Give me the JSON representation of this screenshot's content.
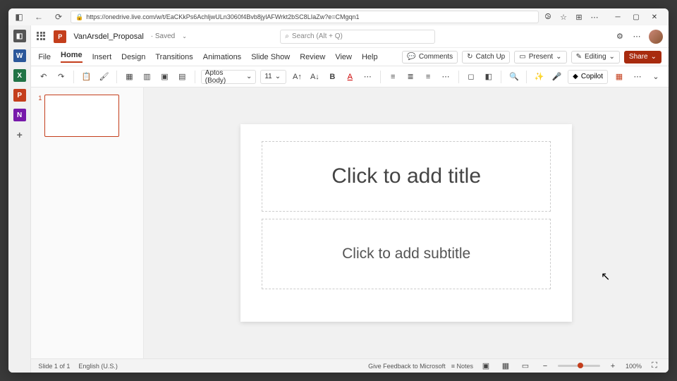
{
  "browser": {
    "url": "https://onedrive.live.com/w/t/EaCKkPs6AchljwULn3060f4Bvb8jylAFWrkt2bSC8LIaZw?e=CMgqn1",
    "favorite": "☆"
  },
  "appstrip": {
    "tab": "◧",
    "word": "W",
    "excel": "X",
    "ppt": "P",
    "onenote": "N",
    "add": "+"
  },
  "title": {
    "doc": "VanArsdel_Proposal",
    "saved": "· Saved",
    "search_ph": "Search (Alt + Q)",
    "settings": "⚙",
    "more": "⋯"
  },
  "tabs": {
    "items": [
      "File",
      "Home",
      "Insert",
      "Design",
      "Transitions",
      "Animations",
      "Slide Show",
      "Review",
      "View",
      "Help"
    ],
    "comments": "Comments",
    "catchup": "Catch Up",
    "present": "Present",
    "editing": "Editing",
    "share": "Share"
  },
  "ribbon": {
    "font": "Aptos (Body)",
    "size": "11",
    "copilot": "Copilot",
    "more": "⋯"
  },
  "thumbs": {
    "num": "1"
  },
  "slide": {
    "title_ph": "Click to add title",
    "sub_ph": "Click to add subtitle"
  },
  "status": {
    "page": "Slide 1 of 1",
    "lang": "English (U.S.)",
    "feedback": "Give Feedback to Microsoft",
    "notes": "Notes",
    "zoom": "100%"
  }
}
